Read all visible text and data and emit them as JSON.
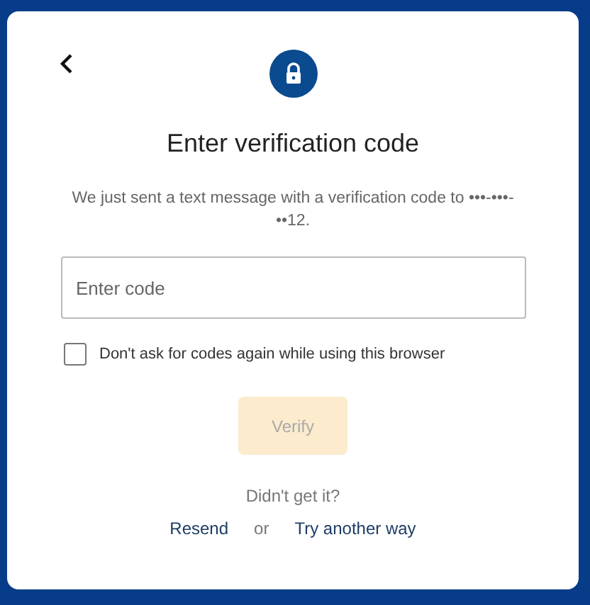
{
  "title": "Enter verification code",
  "message": "We just sent a text message with a verification code to •••-•••-••12.",
  "code_field": {
    "placeholder": "Enter code"
  },
  "remember": {
    "label": "Don't ask for codes again while using this browser",
    "checked": false
  },
  "verify_button": {
    "label": "Verify",
    "disabled": true
  },
  "help": "Didn't get it?",
  "links": [
    {
      "label": "Resend",
      "kind": "link"
    },
    {
      "label": "or",
      "kind": "text"
    },
    {
      "label": "Try another way",
      "kind": "link"
    }
  ]
}
